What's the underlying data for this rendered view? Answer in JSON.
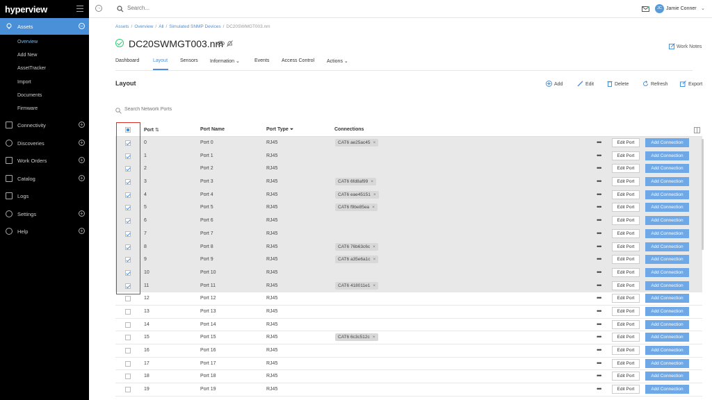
{
  "brand": {
    "logo": "hyperview"
  },
  "sidebar": {
    "assets_label": "Assets",
    "sub_items": [
      {
        "label": "Overview",
        "active": true
      },
      {
        "label": "Add New"
      },
      {
        "label": "AssetTracker"
      },
      {
        "label": "Import"
      },
      {
        "label": "Documents"
      },
      {
        "label": "Firmware"
      }
    ],
    "nav": [
      {
        "label": "Connectivity",
        "icon": "connectivity-icon",
        "plus": true
      },
      {
        "label": "Discoveries",
        "icon": "eye-icon",
        "plus": true
      },
      {
        "label": "Work Orders",
        "icon": "work-orders-icon",
        "plus": true
      },
      {
        "label": "Catalog",
        "icon": "catalog-icon",
        "plus": true
      },
      {
        "label": "Logs",
        "icon": "logs-icon",
        "plus": false
      },
      {
        "label": "Settings",
        "icon": "gear-icon",
        "plus": true
      },
      {
        "label": "Help",
        "icon": "help-icon",
        "plus": true
      }
    ]
  },
  "topbar": {
    "search_placeholder": "Search...",
    "user_initials": "JC",
    "user_name": "Jamie Conner"
  },
  "breadcrumb": [
    "Assets",
    "Overview",
    "All",
    "Simulated SNMP Devices",
    "DC20SWMGT003.nm"
  ],
  "header": {
    "title": "DC20SWMGT003.nm",
    "work_notes": "Work Notes"
  },
  "tabs": [
    {
      "label": "Dashboard"
    },
    {
      "label": "Layout",
      "active": true
    },
    {
      "label": "Sensors"
    },
    {
      "label": "Information ⌄"
    },
    {
      "label": "Events"
    },
    {
      "label": "Access Control"
    },
    {
      "label": "Actions ⌄"
    }
  ],
  "layout": {
    "title": "Layout",
    "toolbar": {
      "add": "Add",
      "edit": "Edit",
      "delete": "Delete",
      "refresh": "Refresh",
      "export": "Export"
    },
    "port_search_placeholder": "Search Network Ports"
  },
  "table": {
    "headers": {
      "port": "Port",
      "port_name": "Port Name",
      "port_type": "Port Type",
      "connections": "Connections"
    },
    "edit_label": "Edit Port",
    "add_label": "Add Connection",
    "more_label": "•••",
    "rows": [
      {
        "port": "0",
        "name": "Port 0",
        "type": "RJ45",
        "conn": "CAT6 ae25ac45",
        "checked": true
      },
      {
        "port": "1",
        "name": "Port 1",
        "type": "RJ45",
        "conn": "",
        "checked": true
      },
      {
        "port": "2",
        "name": "Port 2",
        "type": "RJ45",
        "conn": "",
        "checked": true
      },
      {
        "port": "3",
        "name": "Port 3",
        "type": "RJ45",
        "conn": "CAT6 6fd8af99",
        "checked": true
      },
      {
        "port": "4",
        "name": "Port 4",
        "type": "RJ45",
        "conn": "CAT6 eae45151",
        "checked": true
      },
      {
        "port": "5",
        "name": "Port 5",
        "type": "RJ45",
        "conn": "CAT6 f9be85ea",
        "checked": true
      },
      {
        "port": "6",
        "name": "Port 6",
        "type": "RJ45",
        "conn": "",
        "checked": true
      },
      {
        "port": "7",
        "name": "Port 7",
        "type": "RJ45",
        "conn": "",
        "checked": true
      },
      {
        "port": "8",
        "name": "Port 8",
        "type": "RJ45",
        "conn": "CAT6 76b63c6c",
        "checked": true
      },
      {
        "port": "9",
        "name": "Port 9",
        "type": "RJ45",
        "conn": "CAT6 a35e6a1c",
        "checked": true
      },
      {
        "port": "10",
        "name": "Port 10",
        "type": "RJ45",
        "conn": "",
        "checked": true
      },
      {
        "port": "11",
        "name": "Port 11",
        "type": "RJ45",
        "conn": "CAT6 418011e1",
        "checked": true
      },
      {
        "port": "12",
        "name": "Port 12",
        "type": "RJ45",
        "conn": "",
        "checked": false
      },
      {
        "port": "13",
        "name": "Port 13",
        "type": "RJ45",
        "conn": "",
        "checked": false
      },
      {
        "port": "14",
        "name": "Port 14",
        "type": "RJ45",
        "conn": "",
        "checked": false
      },
      {
        "port": "15",
        "name": "Port 15",
        "type": "RJ45",
        "conn": "CAT6 6c3c512c",
        "checked": false
      },
      {
        "port": "16",
        "name": "Port 16",
        "type": "RJ45",
        "conn": "",
        "checked": false
      },
      {
        "port": "17",
        "name": "Port 17",
        "type": "RJ45",
        "conn": "",
        "checked": false
      },
      {
        "port": "18",
        "name": "Port 18",
        "type": "RJ45",
        "conn": "",
        "checked": false
      },
      {
        "port": "19",
        "name": "Port 19",
        "type": "RJ45",
        "conn": "",
        "checked": false
      }
    ]
  },
  "colors": {
    "accent": "#4a90d9",
    "sidebar_bg": "#000000",
    "success": "#2ecc71",
    "highlight": "#d93025"
  }
}
